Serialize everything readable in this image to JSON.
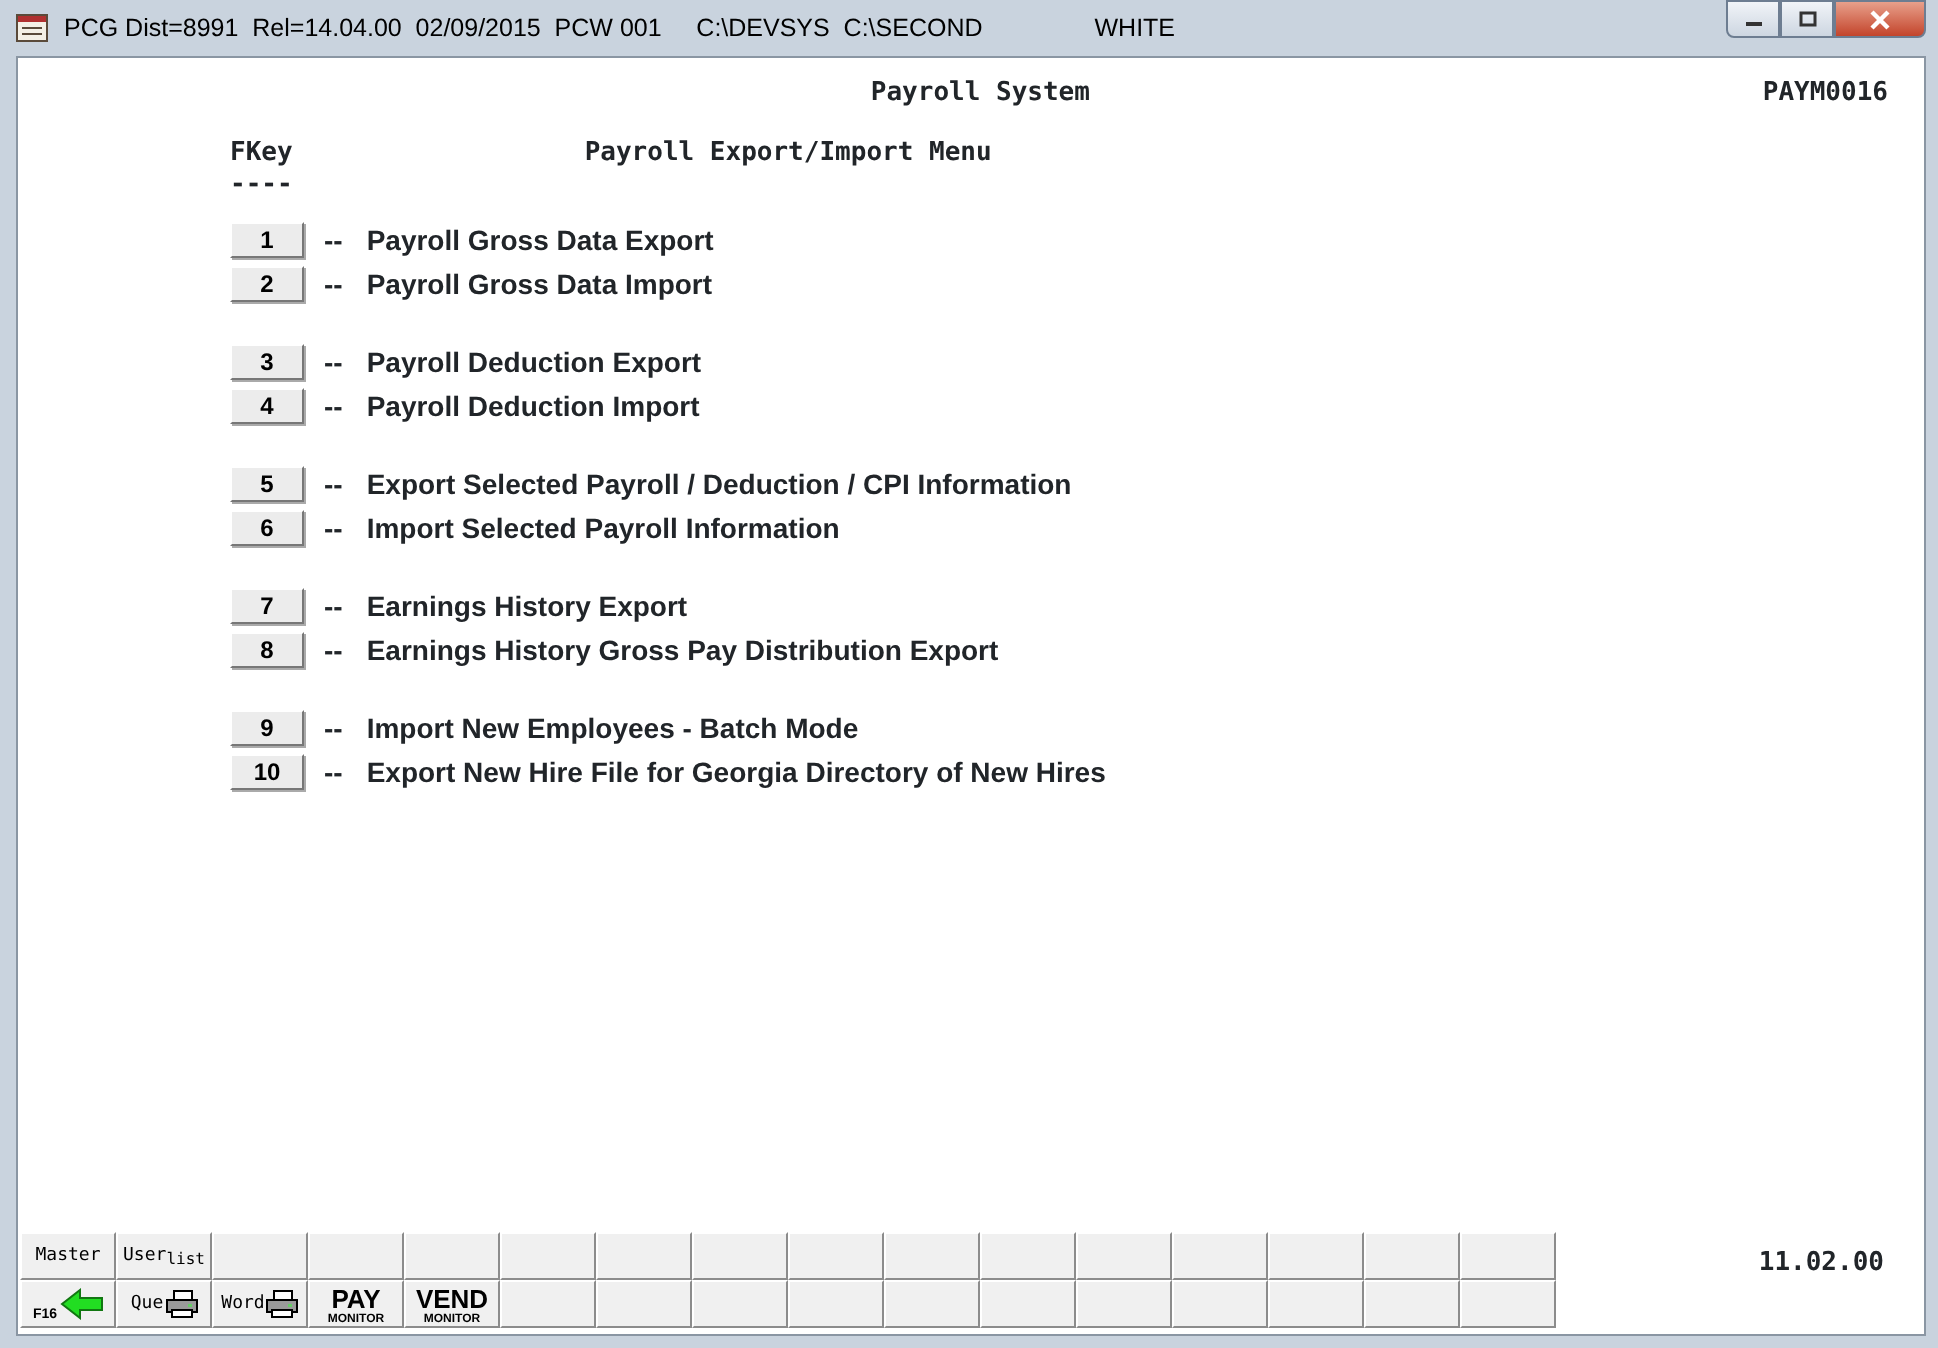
{
  "window": {
    "title": "PCG Dist=8991  Rel=14.04.00  02/09/2015  PCW 001     C:\\DEVSYS  C:\\SECOND",
    "user": "WHITE"
  },
  "header": {
    "system": "Payroll System",
    "screen_id": "PAYM0016"
  },
  "menu": {
    "fkey_heading": "FKey",
    "fkey_rule": "----",
    "title": "Payroll Export/Import Menu",
    "groups": [
      {
        "items": [
          {
            "key": "1",
            "dash": "--",
            "label": "Payroll Gross Data Export"
          },
          {
            "key": "2",
            "dash": "--",
            "label": "Payroll Gross Data Import"
          }
        ]
      },
      {
        "items": [
          {
            "key": "3",
            "dash": "--",
            "label": "Payroll Deduction Export"
          },
          {
            "key": "4",
            "dash": "--",
            "label": "Payroll Deduction Import"
          }
        ]
      },
      {
        "items": [
          {
            "key": "5",
            "dash": "--",
            "label": "Export Selected Payroll / Deduction / CPI Information"
          },
          {
            "key": "6",
            "dash": "--",
            "label": "Import Selected Payroll Information"
          }
        ]
      },
      {
        "items": [
          {
            "key": "7",
            "dash": "--",
            "label": "Earnings History Export"
          },
          {
            "key": "8",
            "dash": "--",
            "label": "Earnings History Gross Pay Distribution Export"
          }
        ]
      },
      {
        "items": [
          {
            "key": "9",
            "dash": "--",
            "label": "Import New Employees - Batch Mode"
          },
          {
            "key": "10",
            "dash": "--",
            "label": "Export New Hire File for Georgia Directory of New Hires"
          }
        ]
      }
    ]
  },
  "toolbar": {
    "rows": [
      {
        "keys": [
          {
            "kind": "text",
            "label": "Master"
          },
          {
            "kind": "text",
            "label": "User$_{list}$"
          },
          {
            "kind": "blank"
          },
          {
            "kind": "blank"
          },
          {
            "kind": "blank"
          },
          {
            "kind": "blank"
          },
          {
            "kind": "blank"
          },
          {
            "kind": "blank"
          },
          {
            "kind": "blank"
          },
          {
            "kind": "blank"
          },
          {
            "kind": "blank"
          },
          {
            "kind": "blank"
          },
          {
            "kind": "blank"
          },
          {
            "kind": "blank"
          },
          {
            "kind": "blank"
          },
          {
            "kind": "blank"
          }
        ]
      },
      {
        "keys": [
          {
            "kind": "back",
            "label": "F16"
          },
          {
            "kind": "printer",
            "label": "Que"
          },
          {
            "kind": "printer",
            "label": "Word"
          },
          {
            "kind": "monitor",
            "label": "PAY",
            "sublabel": "MONITOR"
          },
          {
            "kind": "monitor",
            "label": "VEND",
            "sublabel": "MONITOR"
          },
          {
            "kind": "blank"
          },
          {
            "kind": "blank"
          },
          {
            "kind": "blank"
          },
          {
            "kind": "blank"
          },
          {
            "kind": "blank"
          },
          {
            "kind": "blank"
          },
          {
            "kind": "blank"
          },
          {
            "kind": "blank"
          },
          {
            "kind": "blank"
          },
          {
            "kind": "blank"
          },
          {
            "kind": "blank"
          }
        ]
      }
    ],
    "time": "11.02.00"
  }
}
